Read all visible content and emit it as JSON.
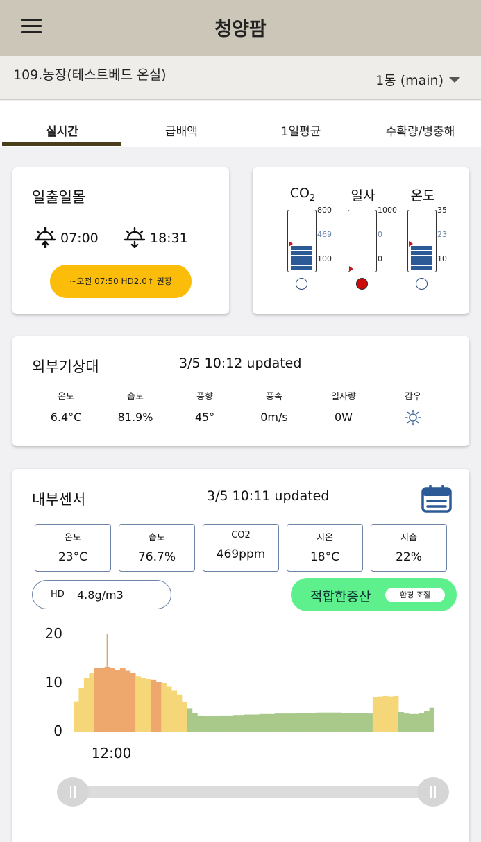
{
  "app": {
    "title": "청양팜"
  },
  "farm": {
    "name": "109.농장(테스트베드 온실)",
    "building": "1동 (main)"
  },
  "tabs": [
    {
      "label": "실시간",
      "active": true
    },
    {
      "label": "급배액",
      "active": false
    },
    {
      "label": "1일평균",
      "active": false
    },
    {
      "label": "수확량/병충해",
      "active": false
    }
  ],
  "sun": {
    "title": "일출일몰",
    "sunrise": "07:00",
    "sunset": "18:31",
    "advice": "~오전 07:50 HD2.0↑ 권장"
  },
  "gauges": [
    {
      "label": "CO",
      "sub": "2",
      "max": "800",
      "current": "469",
      "min": "100",
      "fill_fraction": 0.53,
      "marker_fraction": 0.53,
      "status": "normal"
    },
    {
      "label": "일사",
      "sub": "",
      "max": "1000",
      "current": "0",
      "min": "0",
      "fill_fraction": 0,
      "marker_fraction": 0.06,
      "status": "alert"
    },
    {
      "label": "온도",
      "sub": "",
      "max": "35",
      "current": "23",
      "min": "10",
      "fill_fraction": 0.53,
      "marker_fraction": 0.53,
      "status": "normal"
    }
  ],
  "weather": {
    "title": "외부기상대",
    "updated": "3/5 10:12 updated",
    "items": [
      {
        "label": "온도",
        "value": "6.4°C"
      },
      {
        "label": "습도",
        "value": "81.9%"
      },
      {
        "label": "풍향",
        "value": "45°"
      },
      {
        "label": "풍속",
        "value": "0m/s"
      },
      {
        "label": "일사량",
        "value": "0W"
      },
      {
        "label": "감우",
        "value": "",
        "icon": "sun-icon"
      }
    ]
  },
  "sensors": {
    "title": "내부센서",
    "updated": "3/5 10:11 updated",
    "items": [
      {
        "label": "온도",
        "value": "23°C"
      },
      {
        "label": "습도",
        "value": "76.7%"
      },
      {
        "label": "CO2",
        "value": "469ppm"
      },
      {
        "label": "지온",
        "value": "18°C"
      },
      {
        "label": "지습",
        "value": "22%"
      }
    ],
    "hd": {
      "label": "HD",
      "value": "4.8g/m3"
    },
    "status": {
      "text": "적합한증산",
      "control": "환경 조절"
    }
  },
  "colors": {
    "appbar": "#cbc6b8",
    "advice": "#fbbc0a",
    "status": "#5ef08d",
    "gauge_fill": "#2c5a96",
    "chart_yellow": "#f5d77a",
    "chart_orange": "#eea76c",
    "chart_green": "#a9c98a"
  },
  "chart_data": {
    "type": "area",
    "title": "",
    "xlabel": "",
    "ylabel": "",
    "ylim": [
      0,
      20
    ],
    "yticks": [
      0,
      10,
      20
    ],
    "xticks": [
      {
        "label": "12:00",
        "index": 7
      }
    ],
    "x_tick_label": "12:00",
    "spike": {
      "index": 6,
      "value": 20
    },
    "series": [
      {
        "values": [
          6.2,
          9.0,
          11.0,
          12.0,
          13.0,
          13.0,
          13.3,
          13.0,
          12.6,
          13.0,
          12.5,
          12.0,
          11.4,
          11.0,
          10.8,
          10.6,
          10.2,
          10.0,
          9.2,
          8.5,
          7.6,
          6.0,
          4.8,
          3.8,
          3.3,
          3.2,
          3.2,
          3.2,
          3.3,
          3.3,
          3.3,
          3.4,
          3.4,
          3.5,
          3.5,
          3.5,
          3.6,
          3.6,
          3.6,
          3.7,
          3.7,
          3.7,
          3.7,
          3.8,
          3.8,
          3.8,
          3.8,
          3.9,
          3.9,
          3.9,
          3.9,
          3.9,
          3.8,
          3.8,
          3.8,
          3.8,
          3.8,
          3.7,
          7.0,
          7.2,
          7.3,
          7.2,
          7.3,
          4.0,
          3.7,
          3.6,
          3.6,
          3.8,
          4.2,
          4.9
        ],
        "levels": [
          "y",
          "y",
          "y",
          "y",
          "o",
          "o",
          "o",
          "o",
          "o",
          "o",
          "o",
          "o",
          "y",
          "y",
          "y",
          "o",
          "o",
          "y",
          "y",
          "y",
          "y",
          "y",
          "g",
          "g",
          "g",
          "g",
          "g",
          "g",
          "g",
          "g",
          "g",
          "g",
          "g",
          "g",
          "g",
          "g",
          "g",
          "g",
          "g",
          "g",
          "g",
          "g",
          "g",
          "g",
          "g",
          "g",
          "g",
          "g",
          "g",
          "g",
          "g",
          "g",
          "g",
          "g",
          "g",
          "g",
          "g",
          "g",
          "y",
          "y",
          "y",
          "y",
          "y",
          "g",
          "g",
          "g",
          "g",
          "g",
          "g",
          "g"
        ]
      }
    ],
    "slider_range": [
      0,
      1
    ]
  }
}
